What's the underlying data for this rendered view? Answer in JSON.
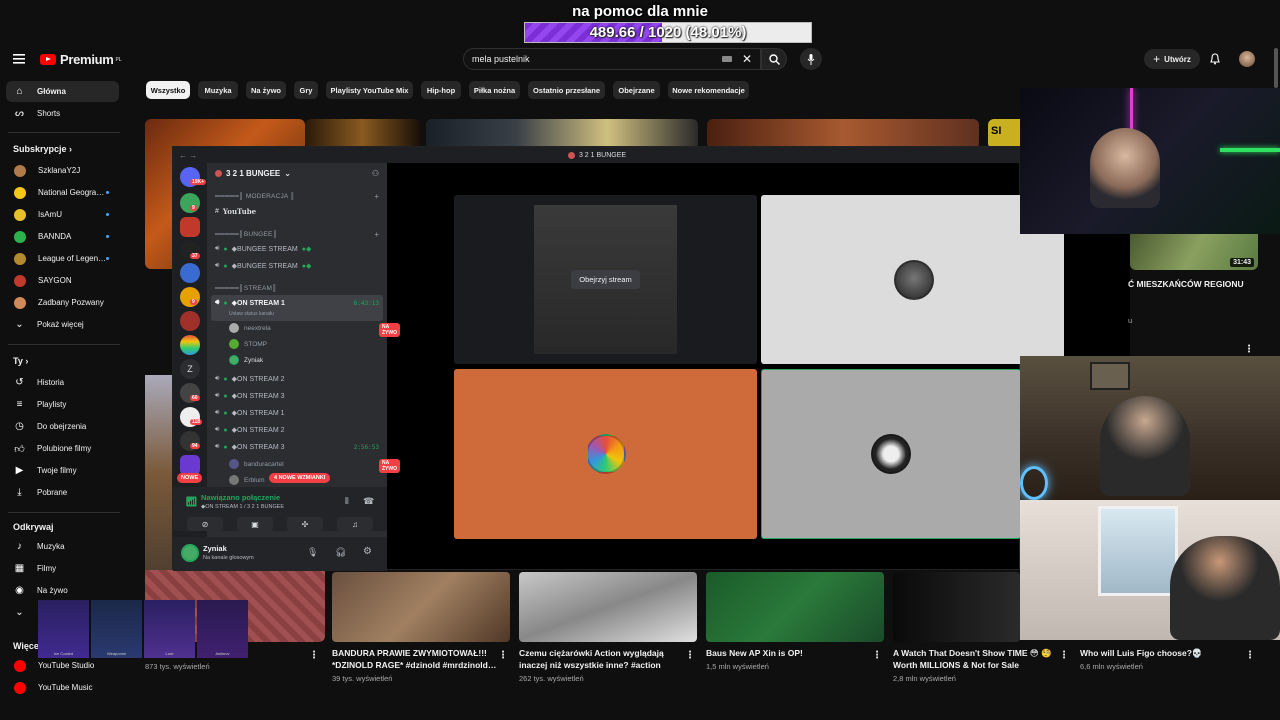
{
  "overlay": {
    "title": "na pomoc dla mnie",
    "progress_text": "489.66 / 1020 (48.01%)",
    "progress_fraction": 0.4801
  },
  "topbar": {
    "logo_text": "Premium",
    "logo_sup": "PL",
    "search_value": "mela pustelnik",
    "create_label": "Utwórz"
  },
  "sidebar": {
    "main": [
      {
        "label": "Główna",
        "icon": "home-icon"
      },
      {
        "label": "Shorts",
        "icon": "shorts-icon"
      }
    ],
    "subs_header": "Subskrypcje",
    "subs": [
      {
        "label": "SzklanaY2J",
        "color": "#b07a4a",
        "new": false
      },
      {
        "label": "National Geogra…",
        "color": "#f5c518",
        "new": true
      },
      {
        "label": "IsAmU",
        "color": "#e8c02a",
        "new": true
      },
      {
        "label": "BANNDA",
        "color": "#2bb24c",
        "new": true
      },
      {
        "label": "League of Legen…",
        "color": "#b38b2e",
        "new": true
      },
      {
        "label": "SAYGON",
        "color": "#c0392b",
        "new": false
      },
      {
        "label": "Zadbany Pozwany",
        "color": "#d08a5a",
        "new": false
      }
    ],
    "show_more": "Pokaż więcej",
    "you_header": "Ty",
    "you": [
      {
        "label": "Historia",
        "icon": "history-icon"
      },
      {
        "label": "Playlisty",
        "icon": "playlist-icon"
      },
      {
        "label": "Do obejrzenia",
        "icon": "clock-icon"
      },
      {
        "label": "Polubione filmy",
        "icon": "like-icon"
      },
      {
        "label": "Twoje filmy",
        "icon": "video-icon"
      },
      {
        "label": "Pobrane",
        "icon": "download-icon"
      }
    ],
    "explore_header": "Odkrywaj",
    "explore": [
      {
        "label": "Muzyka",
        "icon": "music-icon"
      },
      {
        "label": "Filmy",
        "icon": "film-icon"
      },
      {
        "label": "Na żywo",
        "icon": "live-icon"
      }
    ],
    "more_header": "Więce",
    "more": [
      {
        "label": "YouTube Studio"
      },
      {
        "label": "YouTube Music"
      }
    ]
  },
  "chips": [
    "Wszystko",
    "Muzyka",
    "Na żywo",
    "Gry",
    "Playlisty YouTube Mix",
    "Hip-hop",
    "Piłka nożna",
    "Ostatnio przesłane",
    "Obejrzane",
    "Nowe rekomendacje"
  ],
  "discord": {
    "window_title": "3 2 1 BUNGEE",
    "server_name": "3 2 1 BUNGEE",
    "cat_moderacja": "═════║ MODERACJA ║",
    "youtube_channel": "YouTube",
    "cat_bungee": "═════║BUNGEE║",
    "bungee_1": "◆BUNGEE STREAM",
    "bungee_2": "◆BUNGEE STREAM",
    "cat_stream": "═════║STREAM║",
    "on_stream_active": "◆ON STREAM 1",
    "on_stream_active_timer": "6:43:13",
    "status_hint": "Ustaw status kanału",
    "users_1": [
      {
        "name": "neextrela",
        "live": true
      },
      {
        "name": "STOMP",
        "live": false
      },
      {
        "name": "Zyniak",
        "live": false
      }
    ],
    "channels": [
      {
        "label": "◆ON STREAM 2",
        "timer": ""
      },
      {
        "label": "◆ON STREAM 3",
        "timer": ""
      },
      {
        "label": "◆ON STREAM 1",
        "timer": ""
      },
      {
        "label": "◆ON STREAM 2",
        "timer": ""
      },
      {
        "label": "◆ON STREAM 3",
        "timer": "2:56:53"
      }
    ],
    "users_2": [
      {
        "name": "banduracartel",
        "live": true
      },
      {
        "name": "Erblum",
        "live": false
      }
    ],
    "live_badge": "NA ŻYWO",
    "mentions_badge": "4 NOWE WZMIANKI",
    "new_badge": "NOWE",
    "voice_status": "Nawiązano połączenie",
    "voice_channel": "◆ON STREAM 1 / 3 2 1 BUNGEE",
    "user_name": "Zyniak",
    "user_status": "Na kanale głosowym",
    "watch_stream": "Obejrzyj stream",
    "guild_badges": [
      "19K+",
      "9",
      "",
      "37",
      "",
      "9",
      "",
      "",
      "",
      "60",
      "118",
      "94"
    ]
  },
  "right_video": {
    "title_partial": "Ć MIESZKAŃCÓW REGIONU",
    "duration": "31:43",
    "meta_partial": "u"
  },
  "videos": [
    {
      "title": "",
      "meta": "873 tys. wyświetleń"
    },
    {
      "title": "BANDURA PRAWIE ZWYMIOTOWAŁ!!! *DZINOLD RAGE* #dzinold #mrdzinold…",
      "meta": "39 tys. wyświetleń"
    },
    {
      "title": "Czemu ciężarówki Action wyglądają inaczej niż wszystkie inne? #action",
      "meta": "262 tys. wyświetleń"
    },
    {
      "title": "Baus New AP Xin is OP!",
      "meta": "1,5 mln wyświetleń"
    },
    {
      "title": "A Watch That Doesn't Show TIME 😳 🧐 Worth MILLIONS & Not for Sale",
      "meta": "2,8 mln wyświetleń"
    },
    {
      "title": "Who will Luis Figo choose?💀",
      "meta": "6,6 mln wyświetleń"
    }
  ],
  "skins": [
    "Ice Coaled",
    "Weaponmi",
    "Lore",
    "Asiimov"
  ],
  "colors": {
    "yt_red": "#ff0000",
    "discord_green": "#23a55a",
    "discord_red": "#f23f43",
    "donation_purple": "#8a3be6",
    "tile_orange": "#cf6b3a"
  }
}
